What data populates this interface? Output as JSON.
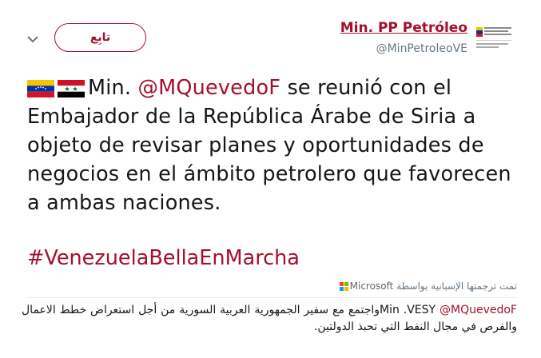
{
  "header": {
    "follow_label": "تابِع",
    "author_name": "Min. PP Petróleo",
    "author_handle": "@MinPetroleoVE"
  },
  "tweet": {
    "text_prefix": "Min. ",
    "mention": "@MQuevedoF",
    "text_body": " se reunió con el Embajador de la República Árabe de Siria a objeto de revisar planes y oportunidades de negocios en el ámbito petrolero que favorecen a ambas naciones.",
    "hashtag": "#VenezuelaBellaEnMarcha"
  },
  "translation": {
    "by_label": "تمت ترجمتها الإسبانية بواسطة",
    "provider": "Microsoft",
    "text_prefix": "Min .VESY ",
    "mention": "@MQuevedoF",
    "text_body": "واجتمع مع سفير الجمهورية العربية السورية من أجل استعراض خطط الاعمال والفرص في مجال النفط التي تحبذ الدولتين."
  },
  "colors": {
    "accent": "#a50f2d",
    "muted": "#657786"
  },
  "icons": {
    "chevron": "chevron-down-icon",
    "avatar": "ministry-logo-icon",
    "flag1": "venezuela-flag-icon",
    "flag2": "syria-flag-icon",
    "provider": "microsoft-logo-icon"
  }
}
